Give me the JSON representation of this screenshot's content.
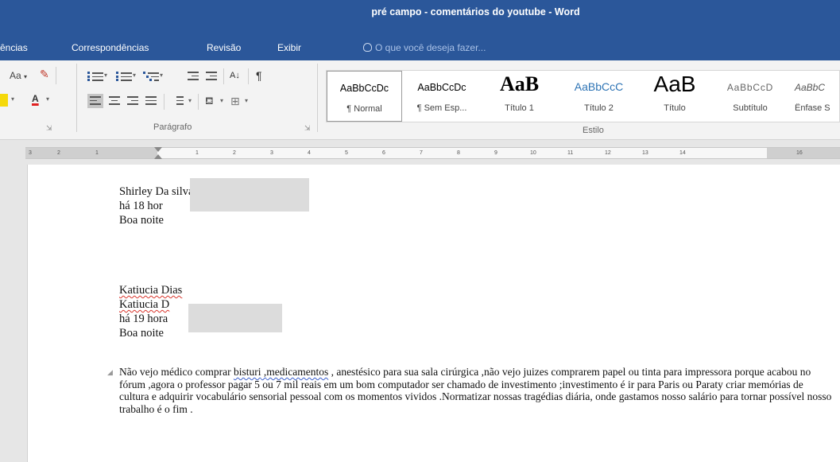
{
  "window": {
    "title": "pré campo - comentários do youtube - Word"
  },
  "tabs": [
    "ências",
    "Correspondências",
    "Revisão",
    "Exibir"
  ],
  "tell_me": {
    "placeholder": "O que você deseja fazer..."
  },
  "ribbon": {
    "font_group": {
      "change_case": "Aa",
      "font_color_letter": "A"
    },
    "paragraph_group": {
      "label": "Parágrafo",
      "sort_glyph": "A↓",
      "pilcrow": "¶"
    },
    "styles_group": {
      "label": "Estilo",
      "styles": [
        {
          "preview": "AaBbCcDc",
          "name": "¶ Normal",
          "selected": true
        },
        {
          "preview": "AaBbCcDc",
          "name": "¶ Sem Esp..."
        },
        {
          "preview": "AaB",
          "name": "Título 1"
        },
        {
          "preview": "AaBbCcC",
          "name": "Título 2"
        },
        {
          "preview": "AaB",
          "name": "Título"
        },
        {
          "preview": "AaBbCcD",
          "name": "Subtítulo"
        },
        {
          "preview": "AaBbC",
          "name": "Ênfase S"
        }
      ]
    }
  },
  "ruler": {
    "left_numbers": [
      "3",
      "2",
      "1"
    ],
    "right_numbers": [
      "1",
      "2",
      "3",
      "4",
      "5",
      "6",
      "7",
      "8",
      "9",
      "10",
      "11",
      "12",
      "13",
      "14",
      "16"
    ]
  },
  "document": {
    "comments": [
      {
        "author": "Shirley Da silva",
        "time": "há 18 hor",
        "text": "Boa noite"
      },
      {
        "author": "Katiucia Dias",
        "author_repeat": "Katiucia D",
        "time": "há 19 hora",
        "text": "Boa noite"
      }
    ],
    "paragraph": {
      "before_bisturi": "Não vejo médico comprar ",
      "bisturi": "bisturi",
      "sep": " ,",
      "medicamentos": "medicamentos",
      "after": " , anestésico para sua sala cirúrgica ,não vejo juizes comprarem papel ou tinta para impressora porque acabou no fórum ,agora o professor pagar 5 ou 7 mil reais em um bom computador ser chamado de investimento ;investimento é ir para Paris ou Paraty criar memórias de cultura e adquirir vocabulário sensorial pessoal com os momentos vividos .Normatizar nossas tragédias diária, onde gastamos nosso salário para tornar possível nosso trabalho é o fim ."
    }
  },
  "colors": {
    "ribbon_blue": "#2b579a",
    "spell_error": "#d9342b",
    "grammar_error": "#3a5fcd"
  }
}
